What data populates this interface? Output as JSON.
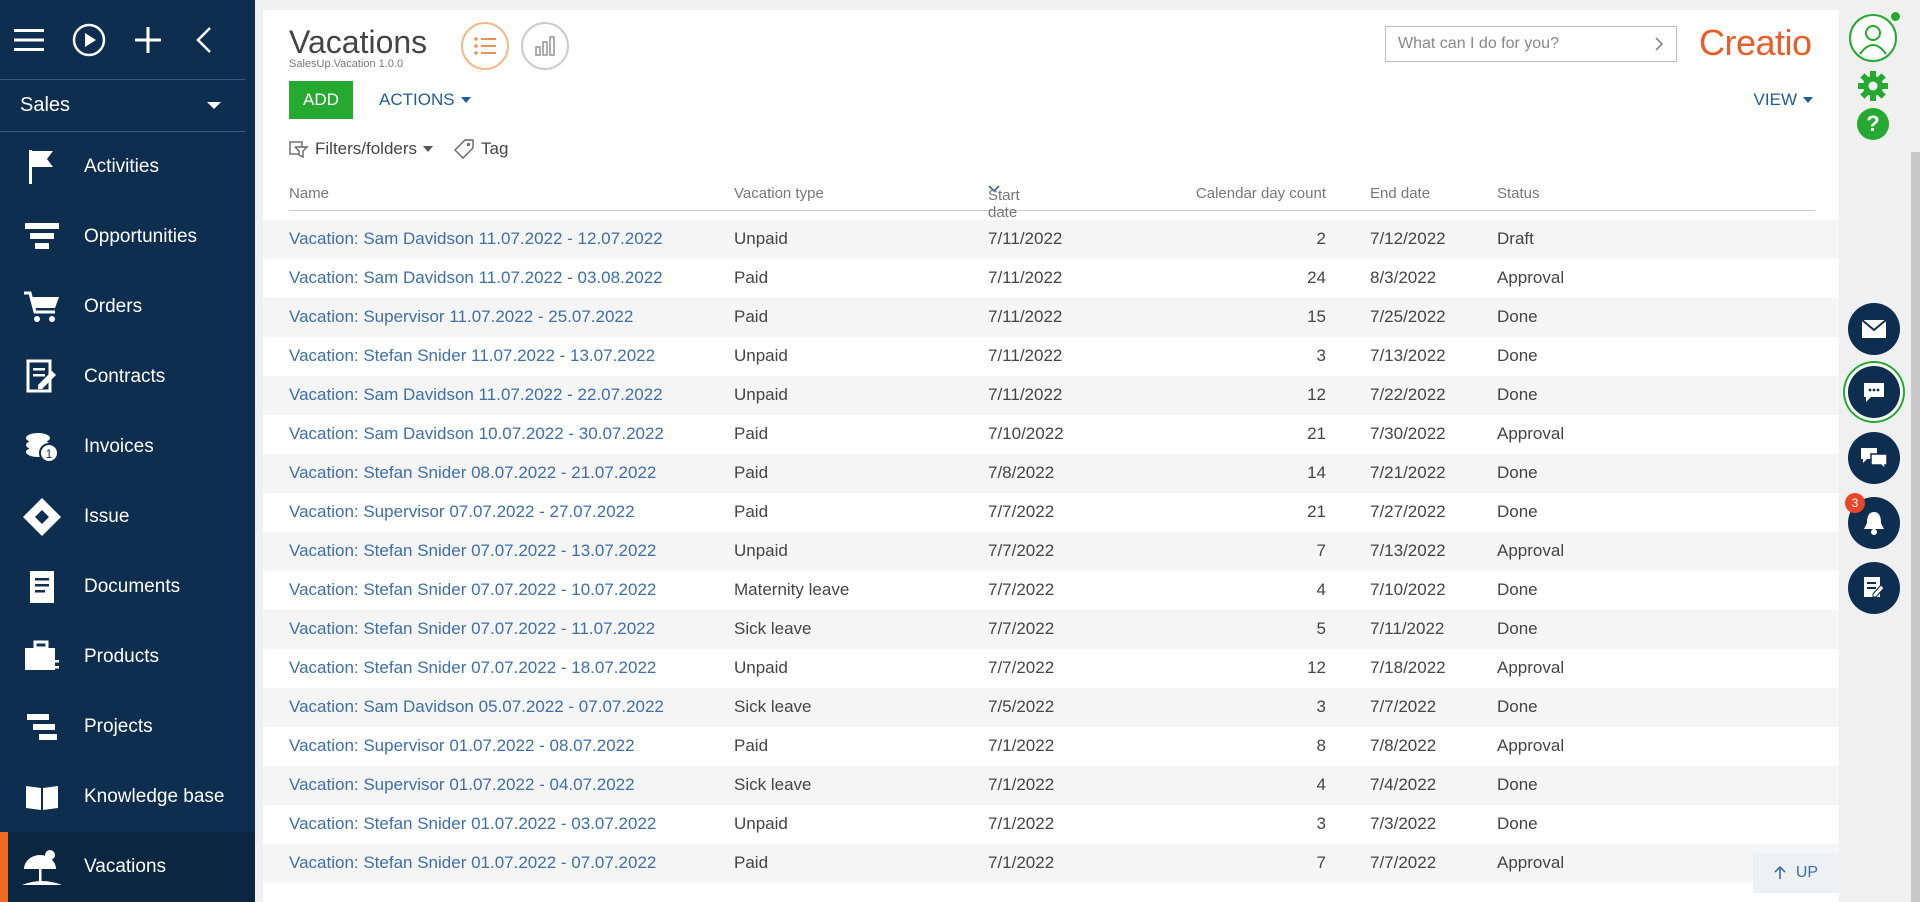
{
  "sidebar": {
    "workplace": "Sales",
    "items": [
      {
        "label": "Activities"
      },
      {
        "label": "Opportunities"
      },
      {
        "label": "Orders"
      },
      {
        "label": "Contracts"
      },
      {
        "label": "Invoices"
      },
      {
        "label": "Issue"
      },
      {
        "label": "Documents"
      },
      {
        "label": "Products"
      },
      {
        "label": "Projects"
      },
      {
        "label": "Knowledge base"
      },
      {
        "label": "Vacations"
      }
    ]
  },
  "header": {
    "title": "Vacations",
    "subtitle": "SalesUp.Vacation 1.0.0",
    "search_placeholder": "What can I do for you?",
    "logo": "Creatio"
  },
  "toolbar": {
    "add_label": "ADD",
    "actions_label": "ACTIONS",
    "view_label": "VIEW",
    "filters_label": "Filters/folders",
    "tag_label": "Tag"
  },
  "table": {
    "columns": {
      "name": "Name",
      "type": "Vacation type",
      "start": "Start date",
      "days": "Calendar day count",
      "end": "End date",
      "status": "Status"
    },
    "rows": [
      {
        "name": "Vacation: Sam Davidson 11.07.2022 - 12.07.2022",
        "type": "Unpaid",
        "start": "7/11/2022",
        "days": "2",
        "end": "7/12/2022",
        "status": "Draft"
      },
      {
        "name": "Vacation: Sam Davidson 11.07.2022 - 03.08.2022",
        "type": "Paid",
        "start": "7/11/2022",
        "days": "24",
        "end": "8/3/2022",
        "status": "Approval"
      },
      {
        "name": "Vacation: Supervisor 11.07.2022 - 25.07.2022",
        "type": "Paid",
        "start": "7/11/2022",
        "days": "15",
        "end": "7/25/2022",
        "status": "Done"
      },
      {
        "name": "Vacation: Stefan Snider 11.07.2022 - 13.07.2022",
        "type": "Unpaid",
        "start": "7/11/2022",
        "days": "3",
        "end": "7/13/2022",
        "status": "Done"
      },
      {
        "name": "Vacation: Sam Davidson 11.07.2022 - 22.07.2022",
        "type": "Unpaid",
        "start": "7/11/2022",
        "days": "12",
        "end": "7/22/2022",
        "status": "Done"
      },
      {
        "name": "Vacation: Sam Davidson 10.07.2022 - 30.07.2022",
        "type": "Paid",
        "start": "7/10/2022",
        "days": "21",
        "end": "7/30/2022",
        "status": "Approval"
      },
      {
        "name": "Vacation: Stefan Snider 08.07.2022 - 21.07.2022",
        "type": "Paid",
        "start": "7/8/2022",
        "days": "14",
        "end": "7/21/2022",
        "status": "Done"
      },
      {
        "name": "Vacation: Supervisor 07.07.2022 - 27.07.2022",
        "type": "Paid",
        "start": "7/7/2022",
        "days": "21",
        "end": "7/27/2022",
        "status": "Done"
      },
      {
        "name": "Vacation: Stefan Snider 07.07.2022 - 13.07.2022",
        "type": "Unpaid",
        "start": "7/7/2022",
        "days": "7",
        "end": "7/13/2022",
        "status": "Approval"
      },
      {
        "name": "Vacation: Stefan Snider 07.07.2022 - 10.07.2022",
        "type": "Maternity leave",
        "start": "7/7/2022",
        "days": "4",
        "end": "7/10/2022",
        "status": "Done"
      },
      {
        "name": "Vacation: Stefan Snider 07.07.2022 - 11.07.2022",
        "type": "Sick leave",
        "start": "7/7/2022",
        "days": "5",
        "end": "7/11/2022",
        "status": "Done"
      },
      {
        "name": "Vacation: Stefan Snider 07.07.2022 - 18.07.2022",
        "type": "Unpaid",
        "start": "7/7/2022",
        "days": "12",
        "end": "7/18/2022",
        "status": "Approval"
      },
      {
        "name": "Vacation: Sam Davidson 05.07.2022 - 07.07.2022",
        "type": "Sick leave",
        "start": "7/5/2022",
        "days": "3",
        "end": "7/7/2022",
        "status": "Done"
      },
      {
        "name": "Vacation: Supervisor 01.07.2022 - 08.07.2022",
        "type": "Paid",
        "start": "7/1/2022",
        "days": "8",
        "end": "7/8/2022",
        "status": "Approval"
      },
      {
        "name": "Vacation: Supervisor 01.07.2022 - 04.07.2022",
        "type": "Sick leave",
        "start": "7/1/2022",
        "days": "4",
        "end": "7/4/2022",
        "status": "Done"
      },
      {
        "name": "Vacation: Stefan Snider 01.07.2022 - 03.07.2022",
        "type": "Unpaid",
        "start": "7/1/2022",
        "days": "3",
        "end": "7/3/2022",
        "status": "Done"
      },
      {
        "name": "Vacation: Stefan Snider 01.07.2022 - 07.07.2022",
        "type": "Paid",
        "start": "7/1/2022",
        "days": "7",
        "end": "7/7/2022",
        "status": "Approval"
      }
    ]
  },
  "scroll_up_label": "UP",
  "notifications_count": "3",
  "colors": {
    "sidebar_bg": "#0d2e4e",
    "accent_orange": "#f26a21",
    "add_green": "#26a931",
    "link_blue": "#3d6fa8",
    "logo_orange": "#e85d2a"
  }
}
